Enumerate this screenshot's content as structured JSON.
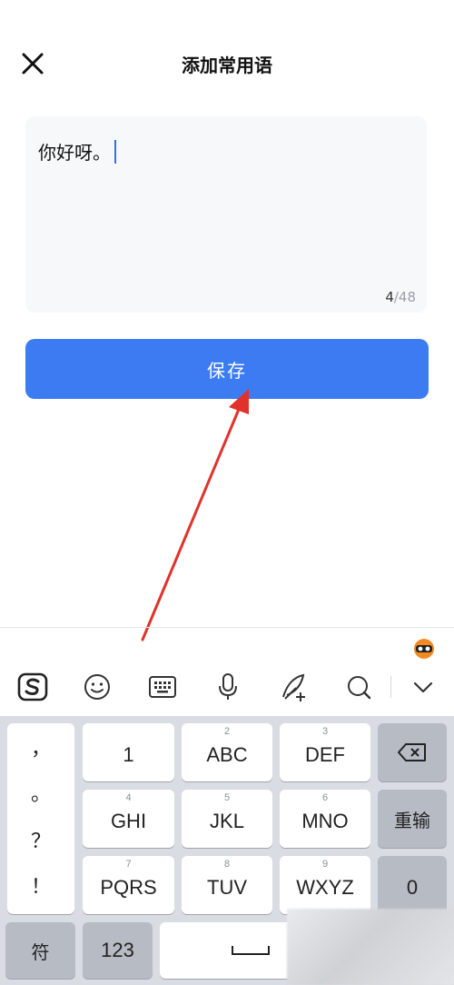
{
  "header": {
    "title": "添加常用语",
    "close_icon": "close-icon"
  },
  "editor": {
    "text": "你好呀。",
    "counter_current": "4",
    "counter_max": "/48"
  },
  "save_button": {
    "label": "保存",
    "color": "#3d7bf3"
  },
  "annotation": {
    "color": "#e0322a"
  },
  "keyboard": {
    "toolbar": [
      "sogou-logo-icon",
      "emoji-icon",
      "keyboard-icon",
      "microphone-icon",
      "handwriting-icon",
      "search-icon",
      "chevron-down-icon"
    ],
    "punctuation": [
      "，",
      "。",
      "？",
      "！"
    ],
    "keys": {
      "k1": {
        "main": "1",
        "sub": ""
      },
      "k2": {
        "main": "ABC",
        "sub": "2"
      },
      "k3": {
        "main": "DEF",
        "sub": "3"
      },
      "k4": {
        "main": "GHI",
        "sub": "4"
      },
      "k5": {
        "main": "JKL",
        "sub": "5"
      },
      "k6": {
        "main": "MNO",
        "sub": "6"
      },
      "k7": {
        "main": "PQRS",
        "sub": "7"
      },
      "k8": {
        "main": "TUV",
        "sub": "8"
      },
      "k9": {
        "main": "WXYZ",
        "sub": "9"
      }
    },
    "reinput": "重输",
    "zero": "0",
    "symbols": "符",
    "numbers": "123"
  }
}
